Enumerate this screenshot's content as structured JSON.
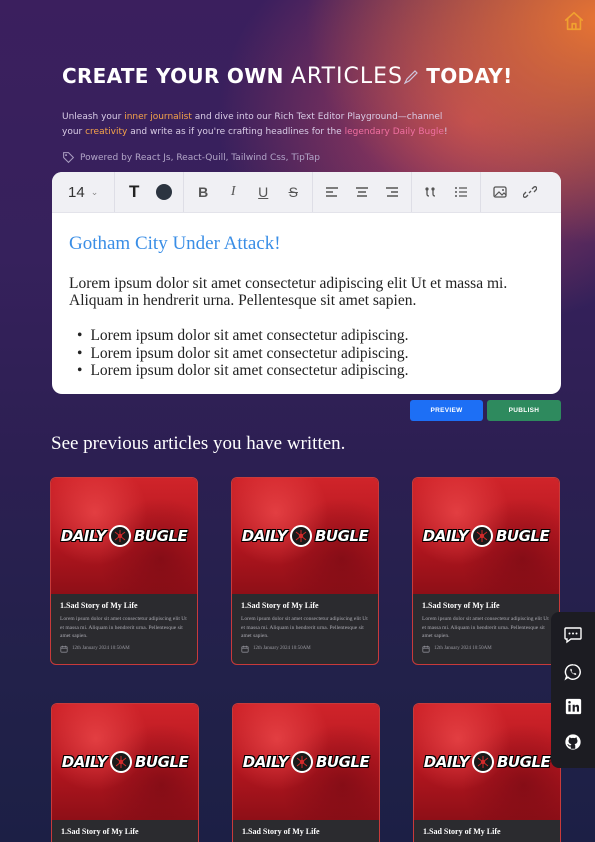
{
  "hero": {
    "title_part1": "CREATE YOUR OWN",
    "title_script": "ARTICLES",
    "title_part2": "TODAY!"
  },
  "intro": {
    "text1": "Unleash your ",
    "highlight1": "inner journalist",
    "text2": " and dive into our Rich Text Editor Playground—channel your ",
    "highlight2": "creativity",
    "text3": " and write as if you're crafting headlines for the ",
    "highlight3": "legendary Daily Bugle",
    "text4": "!"
  },
  "powered_by": "Powered by React Js, React-Quill, Tailwind Css, TipTap",
  "toolbar": {
    "font_size": "14",
    "text_style_icon": "T",
    "bold_label": "B",
    "italic_label": "I",
    "underline_label": "U",
    "strike_label": "S"
  },
  "editor": {
    "title": "Gotham City Under Attack!",
    "paragraph": "Lorem ipsum dolor sit amet consectetur adipiscing elit Ut et massa mi. Aliquam in hendrerit urna. Pellentesque sit amet sapien.",
    "bullets": [
      "Lorem ipsum dolor sit amet consectetur adipiscing.",
      "Lorem ipsum dolor sit amet consectetur adipiscing.",
      "Lorem ipsum dolor sit amet consectetur adipiscing."
    ]
  },
  "actions": {
    "preview_label": "PREVIEW",
    "publish_label": "PUBLISH"
  },
  "section_title": "See previous articles you have written.",
  "articles": [
    {
      "banner_left": "DAILY",
      "banner_right": "BUGLE",
      "title": "1.Sad Story of My Life",
      "excerpt": "Lorem ipsum dolor sit amet consectetur adipiscing elit Ut et massa mi. Aliquam in hendrerit urna. Pellentesque sit amet sapien.",
      "date": "12th January 2024 10:50AM"
    },
    {
      "banner_left": "DAILY",
      "banner_right": "BUGLE",
      "title": "1.Sad Story of My Life",
      "excerpt": "Lorem ipsum dolor sit amet consectetur adipiscing elit Ut et massa mi. Aliquam in hendrerit urna. Pellentesque sit amet sapien.",
      "date": "12th January 2024 10:50AM"
    },
    {
      "banner_left": "DAILY",
      "banner_right": "BUGLE",
      "title": "1.Sad Story of My Life",
      "excerpt": "Lorem ipsum dolor sit amet consectetur adipiscing elit Ut et massa mi. Aliquam in hendrerit urna. Pellentesque sit amet sapien.",
      "date": "12th January 2024 10:50AM"
    },
    {
      "banner_left": "DAILY",
      "banner_right": "BUGLE",
      "title": "1.Sad Story of My Life",
      "excerpt": "",
      "date": ""
    },
    {
      "banner_left": "DAILY",
      "banner_right": "BUGLE",
      "title": "1.Sad Story of My Life",
      "excerpt": "",
      "date": ""
    },
    {
      "banner_left": "DAILY",
      "banner_right": "BUGLE",
      "title": "1.Sad Story of My Life",
      "excerpt": "",
      "date": ""
    }
  ],
  "colors": {
    "accent_blue": "#1d6ff5",
    "accent_green": "#2e8a5e",
    "home_icon": "#f0a030",
    "editor_title": "#3a8ee6",
    "card_border": "#c83a3a"
  },
  "icons": [
    "home-icon",
    "pencil-icon",
    "tag-icon",
    "chevron-down-icon",
    "align-left-icon",
    "align-center-icon",
    "align-right-icon",
    "code-block-icon",
    "bullet-list-icon",
    "image-icon",
    "link-icon",
    "calendar-icon",
    "chat-icon",
    "whatsapp-icon",
    "linkedin-icon",
    "github-icon"
  ]
}
